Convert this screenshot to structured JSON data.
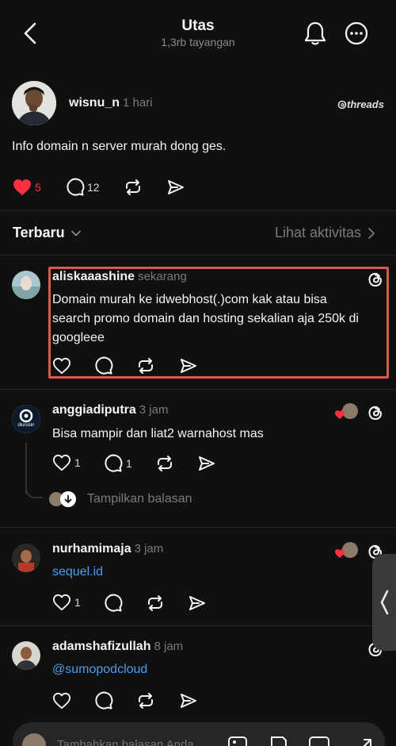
{
  "header": {
    "title": "Utas",
    "views": "1,3rb tayangan"
  },
  "main_post": {
    "username": "wisnu_n",
    "time": "1 hari",
    "brand": "threads",
    "text": "Info domain n server murah dong ges.",
    "likes": "5",
    "comments": "12",
    "liked": true
  },
  "sort": {
    "label": "Terbaru",
    "activity": "Lihat aktivitas"
  },
  "replies": [
    {
      "username": "aliskaaashine",
      "time": "sekarang",
      "lines": [
        "Domain murah ke idwebhost(.)com kak atau bisa",
        "search promo domain dan hosting sekalian aja 250k di",
        "googleee"
      ]
    },
    {
      "username": "anggiadiputra",
      "time": "3 jam",
      "avatar_text": "diurusin",
      "text": "Bisa mampir dan liat2 warnahost mas",
      "likes": "1",
      "comments": "1",
      "show_replies": "Tampilkan balasan"
    },
    {
      "username": "nurhamimaja",
      "time": "3 jam",
      "text": "sequel.id",
      "likes": "1"
    },
    {
      "username": "adamshafizullah",
      "time": "8 jam",
      "text": "@sumopodcloud"
    }
  ],
  "compose": {
    "placeholder": "Tambahkan balasan Anda..."
  },
  "colors": {
    "background": "#101010",
    "like_red": "#ff3040",
    "link_blue": "#4a9ef0",
    "highlight": "#d95a45"
  }
}
